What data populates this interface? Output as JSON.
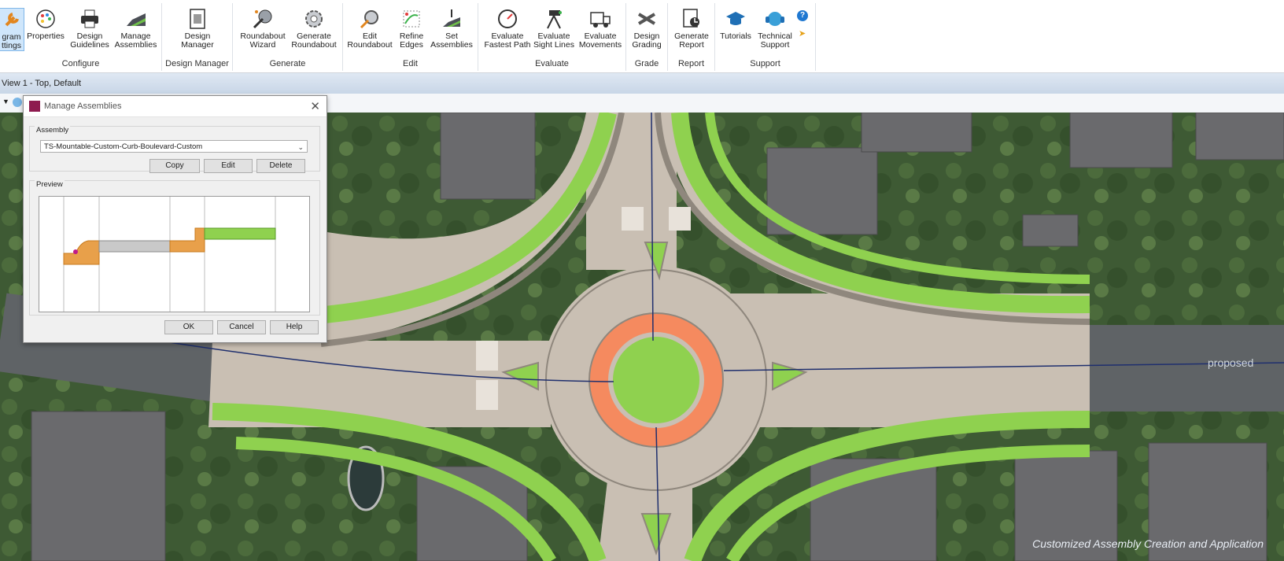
{
  "ribbon": {
    "groups": [
      {
        "label": "Configure",
        "buttons": [
          {
            "label": "gram\nttings",
            "icon": "wrench-icon"
          },
          {
            "label": "Properties",
            "icon": "palette-icon"
          },
          {
            "label": "Design\nGuidelines",
            "icon": "printer-icon"
          },
          {
            "label": "Manage\nAssemblies",
            "icon": "assembly-icon"
          }
        ]
      },
      {
        "label": "Design Manager",
        "buttons": [
          {
            "label": "Design\nManager",
            "icon": "document-icon"
          }
        ]
      },
      {
        "label": "Generate",
        "buttons": [
          {
            "label": "Roundabout\nWizard",
            "icon": "wand-icon"
          },
          {
            "label": "Generate\nRoundabout",
            "icon": "gear-target-icon"
          }
        ]
      },
      {
        "label": "Edit",
        "buttons": [
          {
            "label": "Edit\nRoundabout",
            "icon": "edit-gear-icon"
          },
          {
            "label": "Refine\nEdges",
            "icon": "refine-edges-icon"
          },
          {
            "label": "Set\nAssemblies",
            "icon": "set-assemblies-icon"
          }
        ]
      },
      {
        "label": "Evaluate",
        "buttons": [
          {
            "label": "Evaluate\nFastest Path",
            "icon": "speedometer-icon"
          },
          {
            "label": "Evaluate\nSight Lines",
            "icon": "camera-tripod-icon"
          },
          {
            "label": "Evaluate\nMovements",
            "icon": "truck-icon"
          }
        ]
      },
      {
        "label": "Grade",
        "buttons": [
          {
            "label": "Design\nGrading",
            "icon": "grading-icon"
          }
        ]
      },
      {
        "label": "Report",
        "buttons": [
          {
            "label": "Generate\nReport",
            "icon": "report-icon"
          }
        ]
      },
      {
        "label": "Support",
        "buttons": [
          {
            "label": "Tutorials",
            "icon": "graduation-cap-icon"
          },
          {
            "label": "Technical\nSupport",
            "icon": "headset-icon"
          }
        ]
      }
    ]
  },
  "viewbar": {
    "title": "View 1 - Top, Default"
  },
  "dialog": {
    "title": "Manage Assemblies",
    "assembly_legend": "Assembly",
    "assembly_value": "TS-Mountable-Custom-Curb-Boulevard-Custom",
    "copy": "Copy",
    "edit": "Edit",
    "delete": "Delete",
    "preview_legend": "Preview",
    "ok": "OK",
    "cancel": "Cancel",
    "help": "Help"
  },
  "map": {
    "label": "proposed"
  },
  "caption": "Customized Assembly Creation and Application",
  "colors": {
    "grass": "#8fd14f",
    "ring": "#f58a5f",
    "road": "#c9bfb3",
    "curb": "#8f877d",
    "water": "#e8a04a"
  }
}
